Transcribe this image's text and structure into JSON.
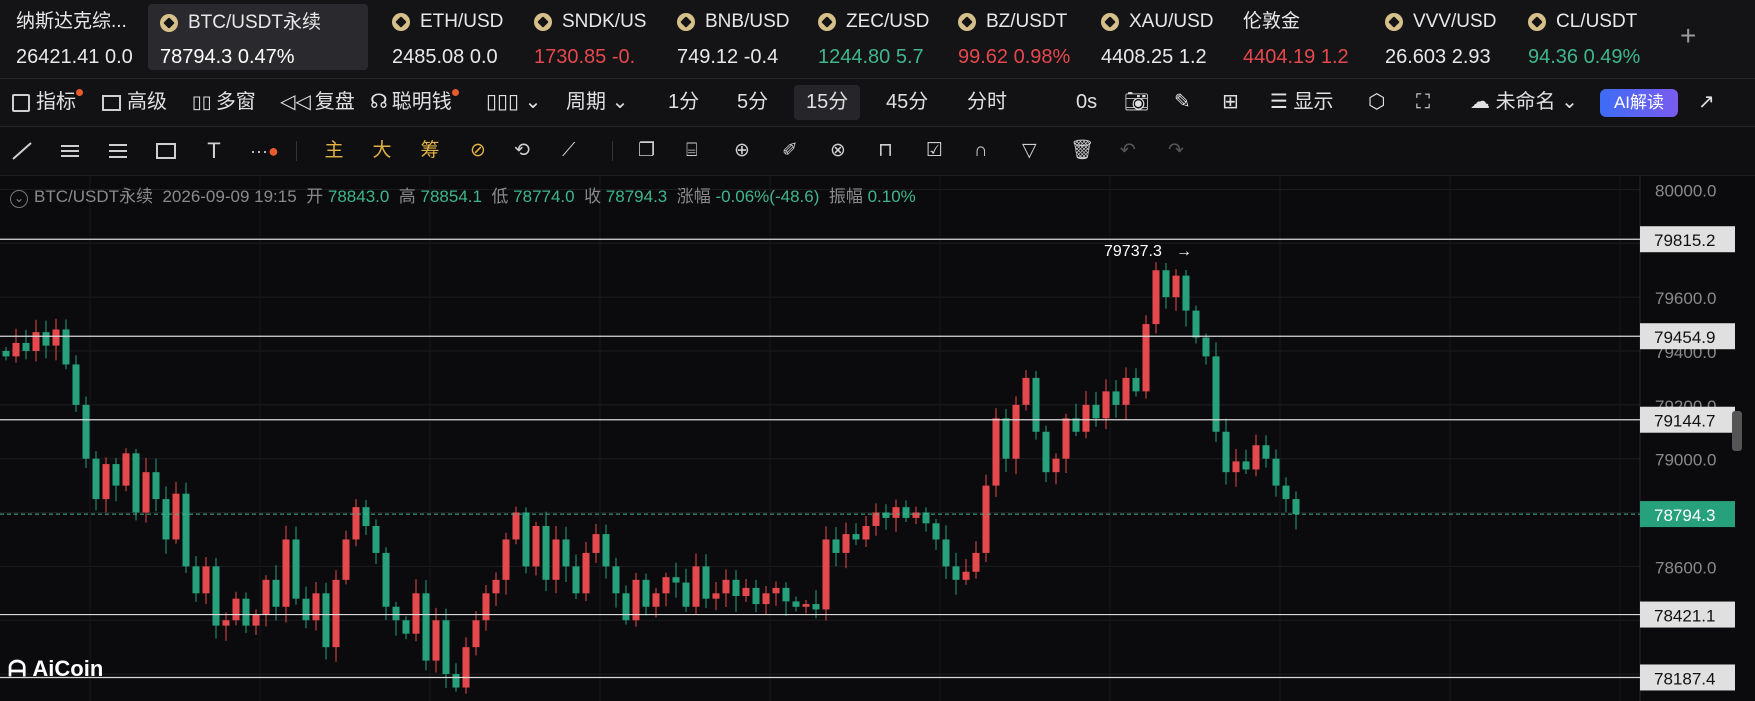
{
  "tickers": [
    {
      "name": "纳斯达克综...",
      "price": "26421.41 0.0",
      "coin": false,
      "color": "#e8e8e8"
    },
    {
      "name": "BTC/USDT永续",
      "price": "78794.3  0.47%",
      "coin": true,
      "active": true,
      "color": "#ffffff"
    },
    {
      "name": "ETH/USD",
      "price": "2485.08 0.0",
      "coin": true,
      "color": "#e8e8e8"
    },
    {
      "name": "SNDK/US",
      "price": "1730.85 -0.",
      "coin": true,
      "color": "#e5484d"
    },
    {
      "name": "BNB/USD",
      "price": "749.12 -0.4",
      "coin": true,
      "color": "#e8e8e8"
    },
    {
      "name": "ZEC/USD",
      "price": "1244.80 5.7",
      "coin": true,
      "color": "#3fb68b"
    },
    {
      "name": "BZ/USDT",
      "price": "99.62 0.98%",
      "coin": true,
      "color": "#e5484d"
    },
    {
      "name": "XAU/USD",
      "price": "4408.25 1.2",
      "coin": true,
      "color": "#e8e8e8"
    },
    {
      "name": "伦敦金",
      "price": "4404.19 1.2",
      "coin": false,
      "color": "#e5484d"
    },
    {
      "name": "VVV/USD",
      "price": "26.603 2.93",
      "coin": true,
      "color": "#e8e8e8"
    },
    {
      "name": "CL/USDT",
      "price": "94.36 0.49%",
      "coin": true,
      "color": "#3fb68b"
    }
  ],
  "plus": "+",
  "toolbar": {
    "indicators": "指标",
    "advanced": "高级",
    "multi": "多窗",
    "replay": "复盘",
    "smart": "聪明钱",
    "period": "周期",
    "p1": "1分",
    "p5": "5分",
    "p15": "15分",
    "p45": "45分",
    "time": "分时",
    "countdown": "0s",
    "display": "显示",
    "layout": "未命名",
    "ai": "AI解读"
  },
  "drawbar": {
    "main": "主",
    "big": "大",
    "chip": "筹"
  },
  "info": {
    "symbol": "BTC/USDT永续",
    "datetime": "2026-09-09 19:15",
    "open_label": "开",
    "open": "78843.0",
    "high_label": "高",
    "high": "78854.1",
    "low_label": "低",
    "low": "78774.0",
    "close_label": "收",
    "close": "78794.3",
    "change_label": "涨幅",
    "change": "-0.06%(-48.6)",
    "amp_label": "振幅",
    "amp": "0.10%"
  },
  "logo": "AiCoin",
  "colors": {
    "up": "#e5484d",
    "down": "#26a17b",
    "bg": "#0b0b0d"
  },
  "chart_data": {
    "type": "candlestick",
    "y_ticks": [
      80000,
      79800,
      79600,
      79400,
      79200,
      79000,
      78800,
      78600,
      78400,
      78200
    ],
    "y_tick_labels": [
      "80000.0",
      "",
      "79600.0",
      "79400.0",
      "79200.0",
      "79000.0",
      "",
      "78600.0",
      "",
      ""
    ],
    "price_lines": [
      79815.2,
      79454.9,
      79144.7,
      78421.1,
      78187.4
    ],
    "price_line_labels": [
      "79815.2",
      "79454.9",
      "79144.7",
      "78421.1",
      "78187.4"
    ],
    "current_price": 78794.3,
    "current_label": "78794.3",
    "high_marker": 79737.3,
    "high_marker_label": "79737.3",
    "ylim": [
      78100,
      80050
    ],
    "closes": [
      79380,
      79430,
      79400,
      79470,
      79420,
      79480,
      79350,
      79200,
      79000,
      78850,
      78980,
      78900,
      79020,
      78800,
      78950,
      78850,
      78700,
      78870,
      78600,
      78500,
      78600,
      78380,
      78400,
      78480,
      78380,
      78420,
      78550,
      78450,
      78700,
      78480,
      78400,
      78500,
      78300,
      78550,
      78700,
      78820,
      78750,
      78650,
      78450,
      78400,
      78350,
      78500,
      78250,
      78400,
      78200,
      78150,
      78300,
      78400,
      78500,
      78550,
      78700,
      78800,
      78600,
      78750,
      78550,
      78700,
      78600,
      78500,
      78650,
      78720,
      78600,
      78500,
      78400,
      78550,
      78450,
      78500,
      78560,
      78540,
      78450,
      78600,
      78480,
      78500,
      78550,
      78490,
      78520,
      78460,
      78500,
      78520,
      78470,
      78450,
      78460,
      78440,
      78700,
      78650,
      78720,
      78700,
      78750,
      78800,
      78780,
      78820,
      78780,
      78800,
      78760,
      78700,
      78600,
      78550,
      78580,
      78650,
      78900,
      79150,
      79000,
      79200,
      79300,
      79100,
      78950,
      79000,
      79150,
      79100,
      79200,
      79150,
      79250,
      79200,
      79300,
      79250,
      79500,
      79700,
      79600,
      79680,
      79550,
      79450,
      79380,
      79100,
      78950,
      78990,
      78960,
      79050,
      79000,
      78900,
      78850,
      78794
    ]
  }
}
